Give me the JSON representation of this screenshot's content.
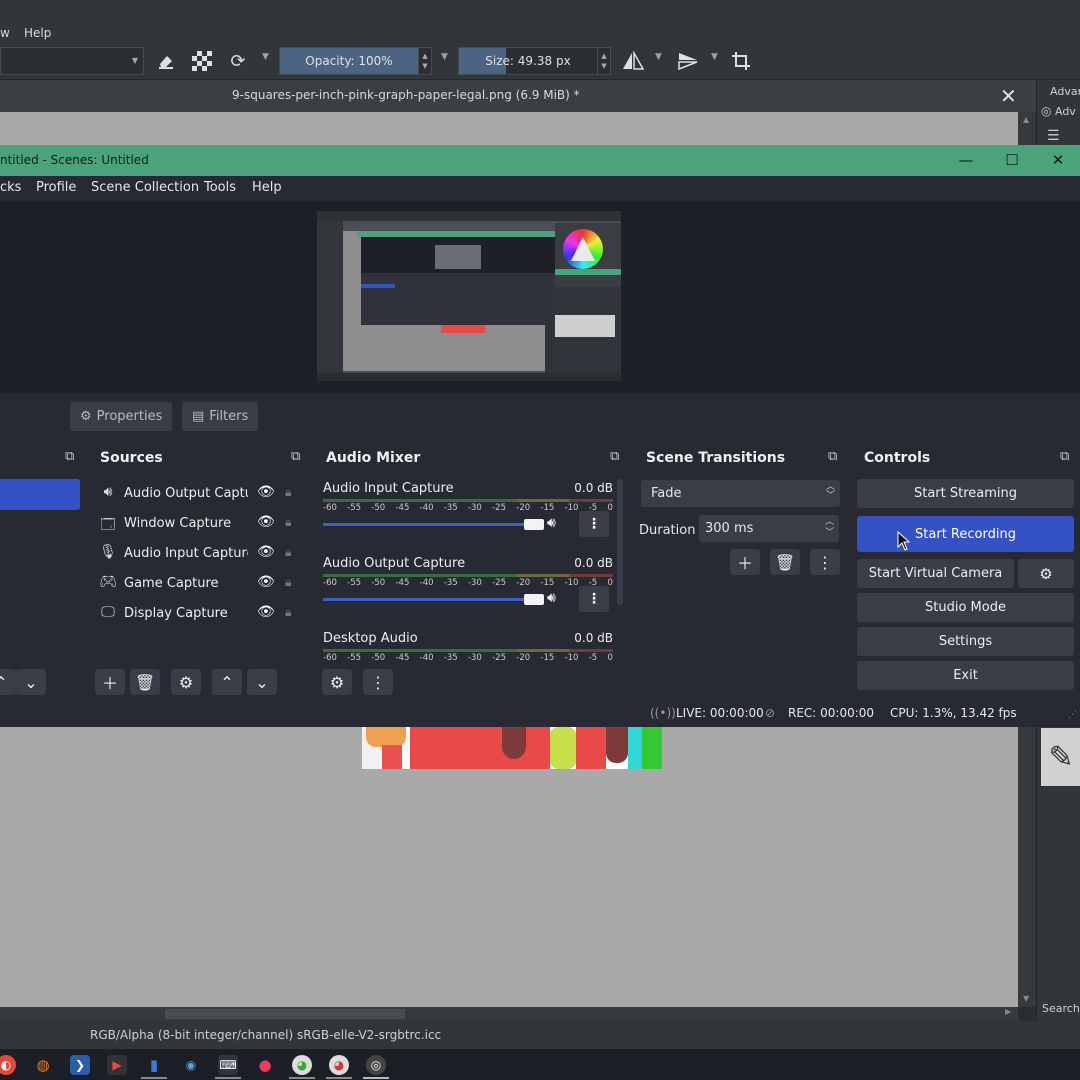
{
  "krita": {
    "menu": {
      "partial_item": "w",
      "help": "Help"
    },
    "toolbar": {
      "opacity": "Opacity: 100%",
      "opacity_fraction": 1.0,
      "size": "Size: 49.38 px",
      "size_fraction": 0.34
    },
    "document_tab": "9-squares-per-inch-pink-graph-paper-legal.png (6.9 MiB) *",
    "docker": {
      "label1": "Advan",
      "label2": "Adv",
      "search": "Search"
    },
    "status": "RGB/Alpha (8-bit integer/channel)  sRGB-elle-V2-srgbtrc.icc"
  },
  "obs": {
    "title": "ntitled - Scenes: Untitled",
    "menu": [
      "cks",
      "Profile",
      "Scene Collection",
      "Tools",
      "Help"
    ],
    "context": {
      "properties": "Properties",
      "filters": "Filters"
    },
    "docks": {
      "sources": {
        "title": "Sources",
        "items": [
          {
            "name": "Audio Output Captu",
            "icon": "speaker-icon"
          },
          {
            "name": "Window Capture",
            "icon": "window-icon"
          },
          {
            "name": "Audio Input Capture",
            "icon": "microphone-icon"
          },
          {
            "name": "Game Capture",
            "icon": "gamepad-icon"
          },
          {
            "name": "Display Capture",
            "icon": "monitor-icon"
          }
        ]
      },
      "mixer": {
        "title": "Audio Mixer",
        "scale": [
          "-60",
          "-55",
          "-50",
          "-45",
          "-40",
          "-35",
          "-30",
          "-25",
          "-20",
          "-15",
          "-10",
          "-5",
          "0"
        ],
        "channels": [
          {
            "name": "Audio Input Capture",
            "db": "0.0 dB",
            "volume": 0.95
          },
          {
            "name": "Audio Output Capture",
            "db": "0.0 dB",
            "volume": 0.95
          },
          {
            "name": "Desktop Audio",
            "db": "0.0 dB"
          }
        ]
      },
      "transitions": {
        "title": "Scene Transitions",
        "selected": "Fade",
        "duration_label": "Duration",
        "duration_value": "300 ms"
      },
      "controls": {
        "title": "Controls",
        "start_streaming": "Start Streaming",
        "start_recording": "Start Recording",
        "start_virtual_camera": "Start Virtual Camera",
        "studio_mode": "Studio Mode",
        "settings": "Settings",
        "exit": "Exit"
      }
    },
    "status": {
      "live": "LIVE: 00:00:00",
      "rec": "REC: 00:00:00",
      "cpu": "CPU: 1.3%, 13.42 fps"
    }
  },
  "colors": {
    "obs_title": "#4aa37a",
    "accent": "#3552c4",
    "krita_bg": "#31363b"
  }
}
